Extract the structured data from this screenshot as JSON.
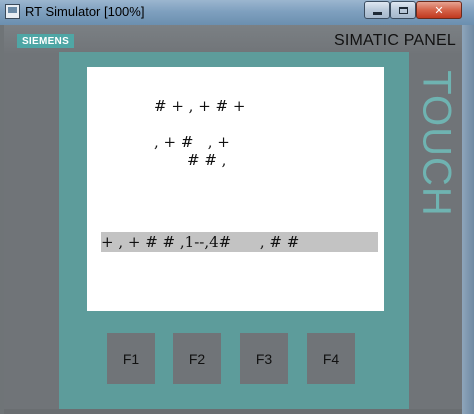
{
  "window": {
    "title": "RT Simulator [100%]",
    "minimize_symbol": "",
    "maximize_symbol": "",
    "close_symbol": "✕"
  },
  "panel": {
    "logo": "SIEMENS",
    "brand": "SIMATIC PANEL",
    "touch_label": "TOUCH"
  },
  "screen": {
    "line1": "# + , + # +",
    "line2": ", + #   , +",
    "line3": "# # ,",
    "status_line": "+ , + # # ,1--,4#      , # #"
  },
  "function_keys": [
    "F1",
    "F2",
    "F3",
    "F4"
  ],
  "colors": {
    "bezel": "#707478",
    "teal_frame": "#5d9c9b",
    "siemens_teal": "#4fa6a5",
    "screen_bg": "#ffffff",
    "status_bar": "#c3c3c3"
  }
}
